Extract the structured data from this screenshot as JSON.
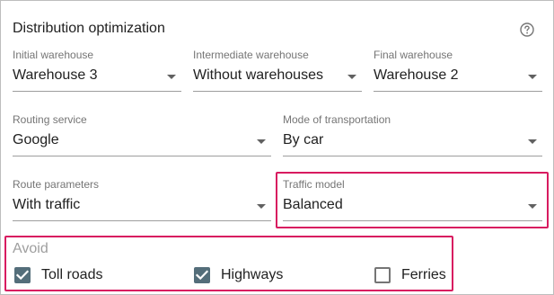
{
  "panel": {
    "title": "Distribution optimization",
    "help_icon": "help-circle-icon"
  },
  "fields": {
    "initial_warehouse": {
      "label": "Initial warehouse",
      "value": "Warehouse 3"
    },
    "intermediate_warehouse": {
      "label": "Intermediate warehouse",
      "value": "Without warehouses"
    },
    "final_warehouse": {
      "label": "Final warehouse",
      "value": "Warehouse 2"
    },
    "routing_service": {
      "label": "Routing service",
      "value": "Google"
    },
    "mode_of_transportation": {
      "label": "Mode of transportation",
      "value": "By car"
    },
    "route_parameters": {
      "label": "Route parameters",
      "value": "With traffic"
    },
    "traffic_model": {
      "label": "Traffic model",
      "value": "Balanced"
    }
  },
  "avoid": {
    "label": "Avoid",
    "options": [
      {
        "label": "Toll roads",
        "checked": true
      },
      {
        "label": "Highways",
        "checked": true
      },
      {
        "label": "Ferries",
        "checked": false
      }
    ]
  },
  "colors": {
    "highlight": "#d81b60",
    "checkbox_checked": "#546e7a"
  }
}
